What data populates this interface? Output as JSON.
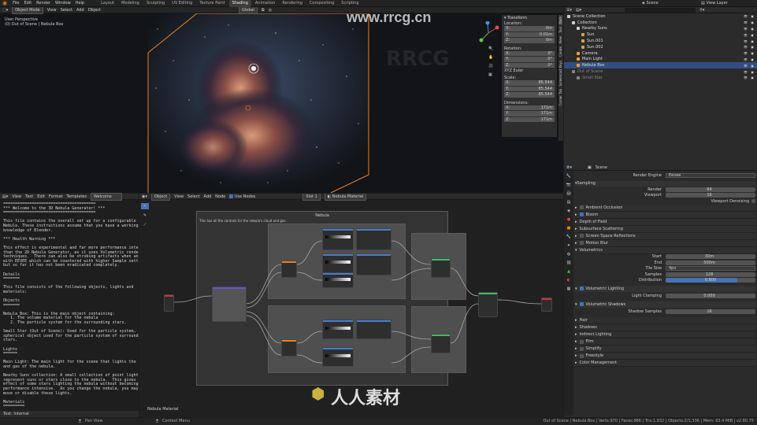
{
  "topbar": {
    "menus": [
      "File",
      "Edit",
      "Render",
      "Window",
      "Help"
    ],
    "workspaces": [
      "Layout",
      "Modeling",
      "Sculpting",
      "UV Editing",
      "Texture Paint",
      "Shading",
      "Animation",
      "Rendering",
      "Compositing",
      "Scripting"
    ],
    "active_workspace": "Shading",
    "scene": "Scene",
    "view_layer": "View Layer"
  },
  "viewport": {
    "mode": "Object Mode",
    "menus": [
      "View",
      "Select",
      "Add",
      "Object"
    ],
    "transform_orientation": "Global",
    "overlay_title": "User Perspective",
    "overlay_sub": "(0) Out of Scene | Nebula Box"
  },
  "transform": {
    "title": "Transform",
    "location_label": "Location:",
    "rotation_label": "Rotation:",
    "euler": "XYZ Euler",
    "scale_label": "Scale:",
    "dimensions_label": "Dimensions:",
    "location": [
      {
        "axis": "X:",
        "value": "0m"
      },
      {
        "axis": "Y:",
        "value": "0.01m"
      },
      {
        "axis": "Z:",
        "value": "0m"
      }
    ],
    "rotation": [
      {
        "axis": "X:",
        "value": "0°"
      },
      {
        "axis": "Y:",
        "value": "0°"
      },
      {
        "axis": "Z:",
        "value": "0°"
      }
    ],
    "scale": [
      {
        "axis": "X:",
        "value": "85.544"
      },
      {
        "axis": "Y:",
        "value": "85.544"
      },
      {
        "axis": "Z:",
        "value": "85.544"
      }
    ],
    "dimensions": [
      {
        "axis": "X:",
        "value": "171m"
      },
      {
        "axis": "Y:",
        "value": "171m"
      },
      {
        "axis": "Z:",
        "value": "171m"
      }
    ],
    "side_tabs": [
      "Item",
      "Tool",
      "View",
      "Create",
      "Screencast Keys",
      "Corner Tab"
    ]
  },
  "outliner": {
    "items": [
      {
        "label": "Scene Collection",
        "indent": 0,
        "color": "#cfcfcf"
      },
      {
        "label": "Collection",
        "indent": 1,
        "color": "#cfcfcf"
      },
      {
        "label": "Nearby Suns",
        "indent": 2,
        "color": "#cfcfcf"
      },
      {
        "label": "Sun",
        "indent": 3,
        "color": "#e8a040"
      },
      {
        "label": "Sun.001",
        "indent": 3,
        "color": "#e8a040"
      },
      {
        "label": "Sun.002",
        "indent": 3,
        "color": "#e8a040"
      },
      {
        "label": "Camera",
        "indent": 2,
        "color": "#e8a040"
      },
      {
        "label": "Main Light",
        "indent": 2,
        "color": "#e8a040"
      },
      {
        "label": "Nebula Box",
        "indent": 2,
        "color": "#e8a040",
        "selected": true
      },
      {
        "label": "Out of Scene",
        "indent": 1,
        "color": "#888"
      },
      {
        "label": "Small Star",
        "indent": 2,
        "color": "#888"
      }
    ]
  },
  "text_editor": {
    "menus": [
      "View",
      "Text",
      "Edit",
      "Format",
      "Templates"
    ],
    "file": "Welcome",
    "footer": "Text: Internal",
    "lines": [
      "=======================================",
      "*** Welcome to the 3D Nebula Generator! ***",
      "=======================================",
      "",
      "This file contains the overall set up for a configurable 3D",
      "Nebula. These instructions assume that you have a working",
      "knowledge of Blender.",
      "",
      "*** Health Warning ***",
      "",
      "This effect is experimental and far more performance intensive",
      "than the 2D Nebula Generator, as it uses Volumetric rendering",
      "techniques.  There can also be strobing artifacts when animating",
      "with EEVEE which can be countered with higher Sample settings",
      "but so far it has not been eradicated completely.",
      "",
      "Details",
      "=======",
      "",
      "This file consists of the following objects, lights and",
      "materials:",
      "",
      "Objects",
      "=======",
      "",
      "Nebula Box: This is the main object containing:",
      "   1. The volume material for the nebula",
      "   2. The particle system for the surrounding stars.",
      "",
      "Small Star (Out of Scene): Used for the particle system, a basic",
      "spherical object used for the particle system of surrounding",
      "stars.",
      "",
      "Lights",
      "======",
      "",
      "Main Light: The main light for the scene that lights the clouds",
      "and gas of the nebula.",
      "",
      "Nearby Suns collection: A small collection of point lights that",
      "represent suns or stars close to the nebula.  This gives the",
      "effect of some stars lighting the nebula without becoming too",
      "performance intensive.  As you change the nebula, you may wish to",
      "move or disable these lights.",
      "",
      "Materials",
      "========="
    ]
  },
  "node_editor": {
    "mode": "Object",
    "menus": [
      "View",
      "Select",
      "Add",
      "Node"
    ],
    "use_nodes": "Use Nodes",
    "slot": "Slot 1",
    "material": "Nebula Material",
    "frame_title": "Nebula",
    "frame_note": "This has all the controls for the nebula's cloud and gas.",
    "footer_material": "Nebula Material"
  },
  "properties": {
    "scene": "Scene",
    "render_engine_label": "Render Engine",
    "render_engine": "Eevee",
    "sampling": "Sampling",
    "render_label": "Render",
    "render_val": "64",
    "viewport_label": "Viewport",
    "viewport_val": "16",
    "vp_denoise": "Viewport Denoising",
    "panels_a": [
      "Ambient Occlusion",
      "Bloom",
      "Depth of Field",
      "Subsurface Scattering",
      "Screen Space Reflections",
      "Motion Blur",
      "Volumetrics"
    ],
    "start_label": "Start",
    "start_val": "30m",
    "end_label": "End",
    "end_val": "500m",
    "tile_label": "Tile Size",
    "tile_val": "4px",
    "samples_label": "Samples",
    "samples_val": "128",
    "dist_label": "Distribution",
    "dist_val": "0.800",
    "dist_fraction": 0.8,
    "vol_light": "Volumetric Lighting",
    "light_clamp_label": "Light Clamping",
    "light_clamp_val": "0.000",
    "vol_shadows": "Volumetric Shadows",
    "shadow_samples_label": "Shadow Samples",
    "shadow_samples_val": "16",
    "panels_b": [
      "Hair",
      "Shadows",
      "Indirect Lighting",
      "Film",
      "Simplify",
      "Freestyle",
      "Color Management"
    ]
  },
  "statusbar": {
    "left": "Pan View",
    "middle": "Context Menu",
    "right": "Out of Scene | Nebula Box | Verts:970 | Faces:966 | Tris:1,932 | Objects:2/1,336 | Mem: 63.4 MiB | v2.80.75"
  },
  "watermarks": [
    "www.rrcg.cn",
    "人人素材",
    "RRCG"
  ]
}
